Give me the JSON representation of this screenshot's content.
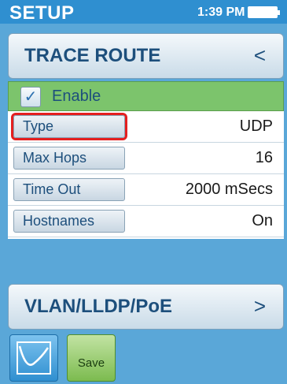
{
  "status": {
    "title": "SETUP",
    "time": "1:39 PM",
    "battery_icon": "battery-icon"
  },
  "trace_header": {
    "title": "TRACE ROUTE",
    "arrow": "<"
  },
  "enable": {
    "checked": true,
    "check_glyph": "✓",
    "label": "Enable"
  },
  "settings": [
    {
      "label": "Type",
      "value": "UDP",
      "selected": true
    },
    {
      "label": "Max Hops",
      "value": "16",
      "selected": false
    },
    {
      "label": "Time Out",
      "value": "2000 mSecs",
      "selected": false
    },
    {
      "label": "Hostnames",
      "value": "On",
      "selected": false
    }
  ],
  "vlan_header": {
    "title": "VLAN/LLDP/PoE",
    "arrow": ">"
  },
  "toolbar": {
    "graph_icon": "graph-icon",
    "save_label": "Save"
  },
  "colors": {
    "background": "#5aa7d8",
    "status_bar": "#2f8fd0",
    "enable_row": "#7cc46c",
    "selection_outline": "#e41f1f",
    "header_text": "#1d4f7c"
  }
}
